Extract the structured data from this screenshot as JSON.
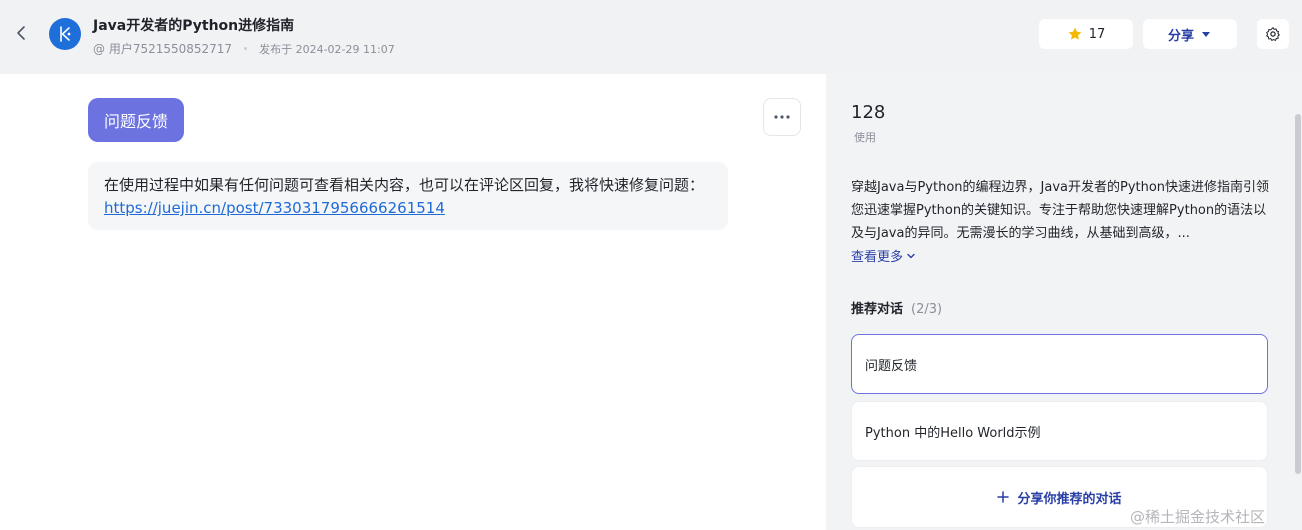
{
  "header": {
    "title": "Java开发者的Python进修指南",
    "author": "@ 用户7521550852717",
    "published": "发布于 2024-02-29 11:07",
    "star_count": "17",
    "share_label": "分享"
  },
  "main": {
    "chip_label": "问题反馈",
    "message_text": "在使用过程中如果有任何问题可查看相关内容，也可以在评论区回复，我将快速修复问题：",
    "message_link": "https://juejin.cn/post/7330317956666261514"
  },
  "sidebar": {
    "uses_count": "128",
    "uses_label": "使用",
    "description": "穿越Java与Python的编程边界，Java开发者的Python快速进修指南引领您迅速掌握Python的关键知识。专注于帮助您快速理解Python的语法以及与Java的异同。无需漫长的学习曲线，从基础到高级，...",
    "see_more": "查看更多",
    "recommend_title": "推荐对话",
    "recommend_count": "(2/3)",
    "recommend_items": [
      {
        "label": "问题反馈"
      },
      {
        "label": "Python 中的Hello World示例"
      }
    ],
    "share_recommend": "分享你推荐的对话"
  },
  "watermark": "@稀土掘金技术社区",
  "colors": {
    "accent": "#6c72e0",
    "link": "#1f6ad6",
    "brand_blue": "#2a3fa6",
    "star": "#f5b800",
    "avatar": "#1e6fd9"
  }
}
